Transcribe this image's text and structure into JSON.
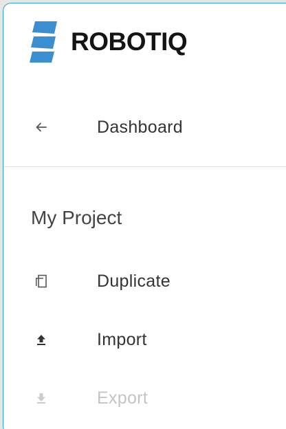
{
  "brand": {
    "name": "ROBOTIQ",
    "logo_color": "#3b8fd0"
  },
  "nav": {
    "back": {
      "icon": "arrow-left-icon",
      "label": "Dashboard"
    }
  },
  "project": {
    "title": "My Project",
    "actions": [
      {
        "icon": "copy-icon",
        "label": "Duplicate",
        "enabled": true
      },
      {
        "icon": "upload-icon",
        "label": "Import",
        "enabled": true
      },
      {
        "icon": "download-icon",
        "label": "Export",
        "enabled": false
      }
    ]
  },
  "colors": {
    "accent_border": "#2ba0d8",
    "text": "#333333",
    "disabled_text": "#c4c4c4"
  }
}
